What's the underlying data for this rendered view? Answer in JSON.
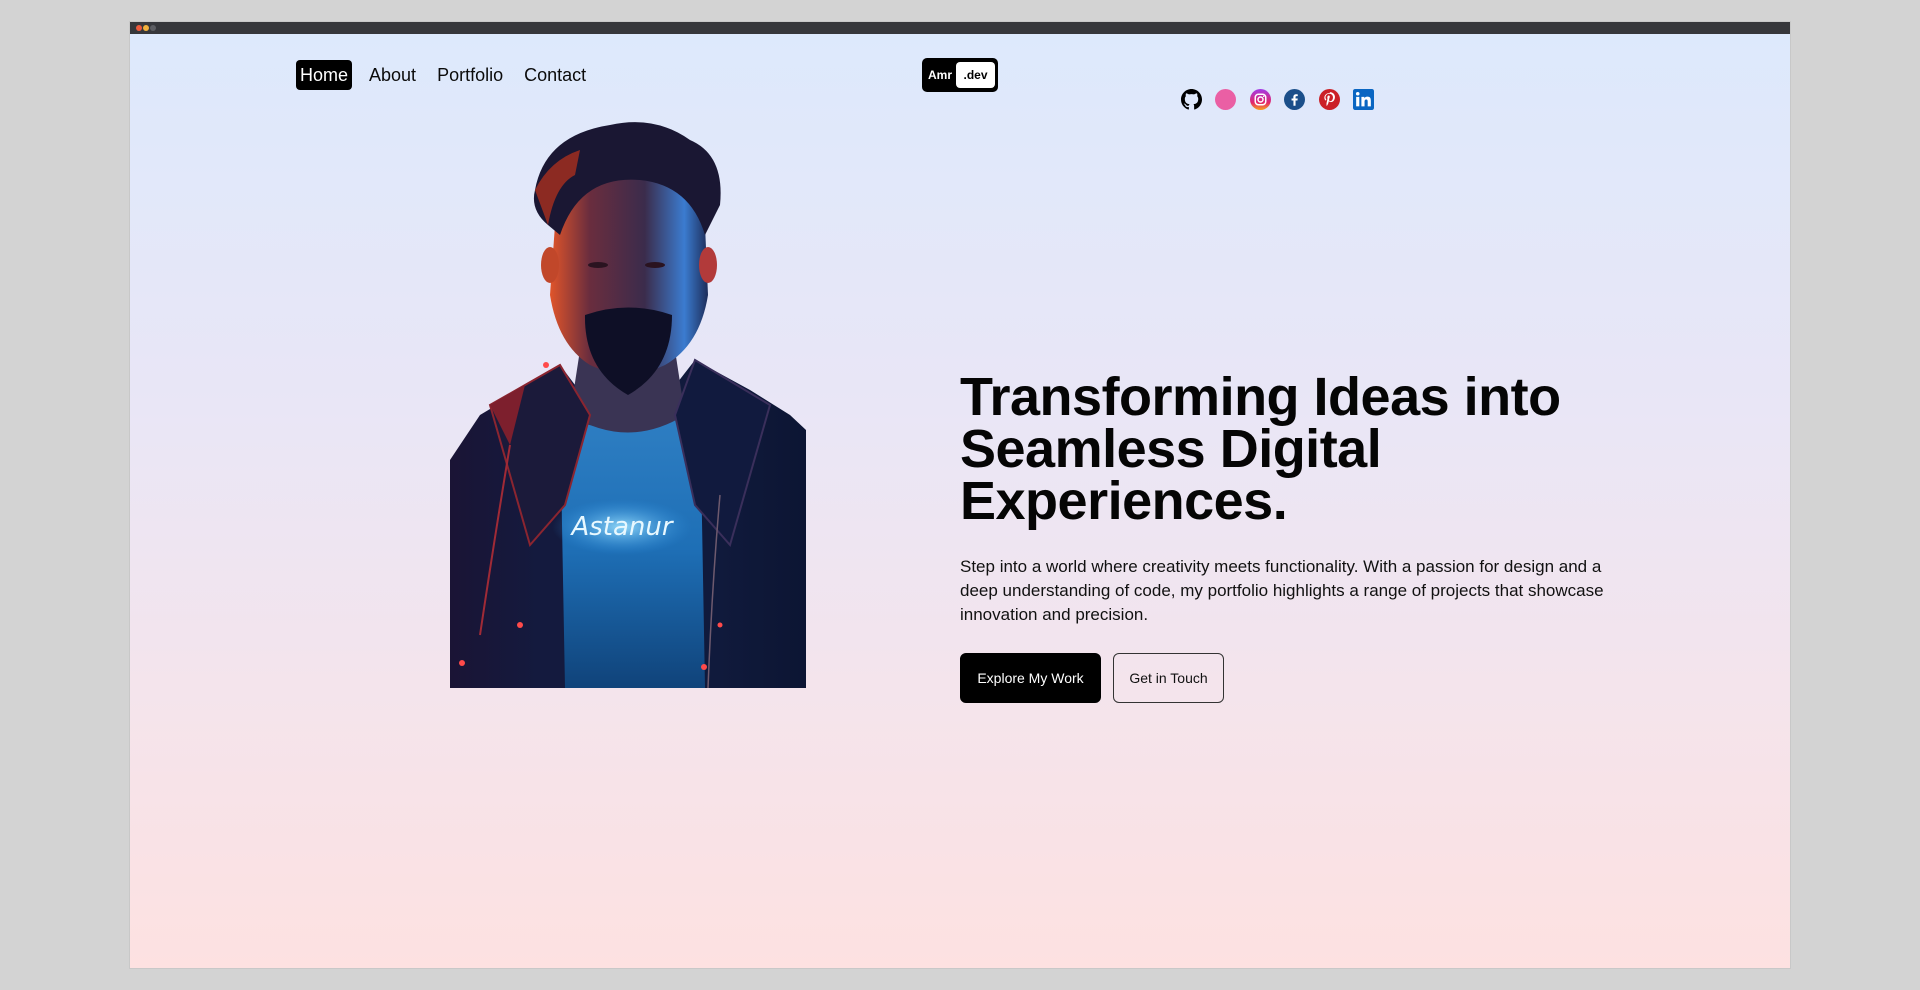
{
  "window": {
    "controls": [
      "close",
      "minimize",
      "maximize"
    ]
  },
  "nav": {
    "items": [
      {
        "label": "Home",
        "active": true
      },
      {
        "label": "About",
        "active": false
      },
      {
        "label": "Portfolio",
        "active": false
      },
      {
        "label": "Contact",
        "active": false
      }
    ]
  },
  "logo": {
    "prefix": "Amr",
    "suffix": ".dev"
  },
  "socials": [
    {
      "name": "github-icon",
      "color": "#000000"
    },
    {
      "name": "dribbble-icon",
      "color": "#ea4c89"
    },
    {
      "name": "instagram-icon",
      "color": "#c837ab"
    },
    {
      "name": "facebook-icon",
      "color": "#1b4f8a"
    },
    {
      "name": "pinterest-icon",
      "color": "#cb2027"
    },
    {
      "name": "linkedin-icon",
      "color": "#0a66c2"
    }
  ],
  "hero": {
    "portrait_alt": "Illustrated portrait of a bearded man in a dark jacket with a glowing T-shirt",
    "shirt_text": "Astanur",
    "headline_lines": [
      "Transforming Ideas into",
      "Seamless Digital",
      "Experiences."
    ],
    "paragraph": "Step into a world where creativity meets functionality. With a passion for design and a deep understanding of code, my portfolio highlights a range of projects that showcase innovation and precision.",
    "primary_cta": "Explore My Work",
    "secondary_cta": "Get in Touch"
  },
  "colors": {
    "gradient_top": "#dde9fc",
    "gradient_bottom": "#fde1e1",
    "accent": "#000000"
  }
}
